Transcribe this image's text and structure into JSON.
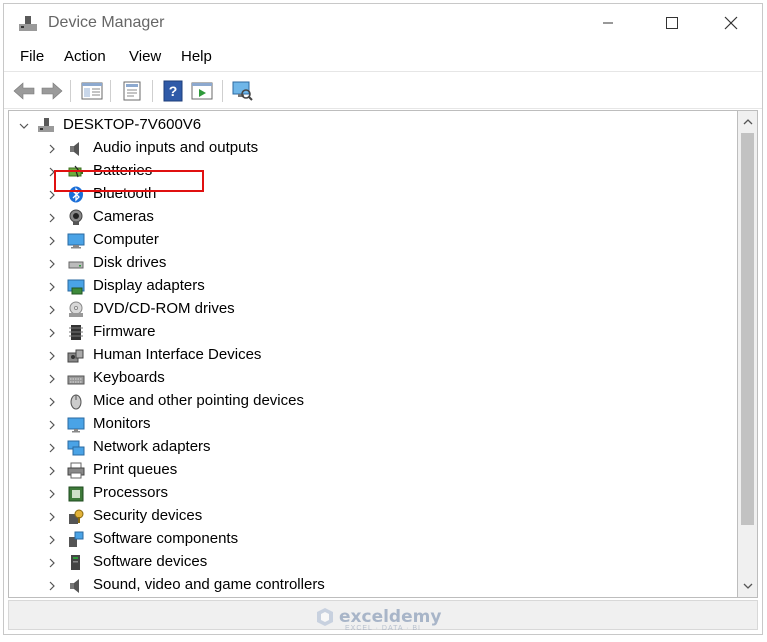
{
  "window": {
    "title": "Device Manager"
  },
  "menu": {
    "file": "File",
    "action": "Action",
    "view": "View",
    "help": "Help"
  },
  "toolbar": {
    "icons": [
      "back-arrow-icon",
      "forward-arrow-icon",
      "show-hide-tree-icon",
      "properties-icon",
      "help-icon",
      "run-icon",
      "scan-hardware-icon"
    ]
  },
  "tree": {
    "root": "DESKTOP-7V600V6",
    "items": [
      {
        "label": "Audio inputs and outputs",
        "icon": "speaker-icon"
      },
      {
        "label": "Batteries",
        "icon": "battery-icon"
      },
      {
        "label": "Bluetooth",
        "icon": "bluetooth-icon"
      },
      {
        "label": "Cameras",
        "icon": "camera-icon"
      },
      {
        "label": "Computer",
        "icon": "computer-icon"
      },
      {
        "label": "Disk drives",
        "icon": "disk-drive-icon"
      },
      {
        "label": "Display adapters",
        "icon": "display-adapter-icon"
      },
      {
        "label": "DVD/CD-ROM drives",
        "icon": "dvd-drive-icon"
      },
      {
        "label": "Firmware",
        "icon": "firmware-icon"
      },
      {
        "label": "Human Interface Devices",
        "icon": "hid-icon"
      },
      {
        "label": "Keyboards",
        "icon": "keyboard-icon"
      },
      {
        "label": "Mice and other pointing devices",
        "icon": "mouse-icon"
      },
      {
        "label": "Monitors",
        "icon": "monitor-icon"
      },
      {
        "label": "Network adapters",
        "icon": "network-adapter-icon"
      },
      {
        "label": "Print queues",
        "icon": "printer-icon"
      },
      {
        "label": "Processors",
        "icon": "processor-icon"
      },
      {
        "label": "Security devices",
        "icon": "security-device-icon"
      },
      {
        "label": "Software components",
        "icon": "software-component-icon"
      },
      {
        "label": "Software devices",
        "icon": "software-device-icon"
      },
      {
        "label": "Sound, video and game controllers",
        "icon": "sound-controller-icon"
      }
    ]
  },
  "highlight_color": "#e01010",
  "watermark": {
    "name": "exceldemy",
    "tagline": "EXCEL · DATA · BI"
  }
}
